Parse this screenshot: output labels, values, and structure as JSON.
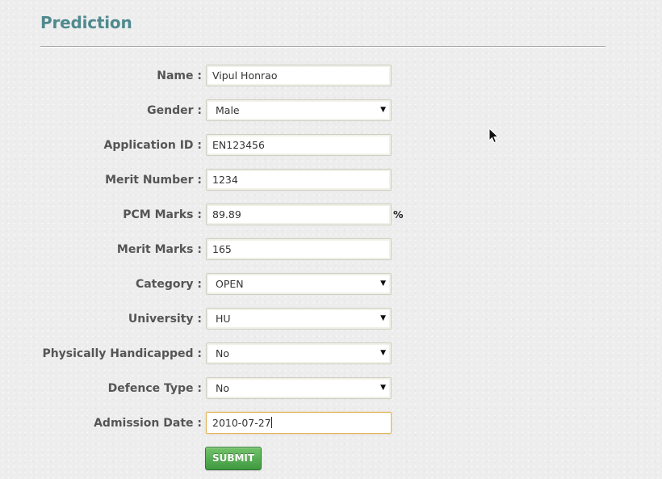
{
  "page": {
    "title": "Prediction"
  },
  "form": {
    "name": {
      "label": "Name :",
      "value": "Vipul Honrao"
    },
    "gender": {
      "label": "Gender :",
      "selected": "Male"
    },
    "application_id": {
      "label": "Application ID :",
      "value": "EN123456"
    },
    "merit_number": {
      "label": "Merit Number :",
      "value": "1234"
    },
    "pcm_marks": {
      "label": "PCM Marks :",
      "value": "89.89",
      "unit": "%"
    },
    "merit_marks": {
      "label": "Merit Marks :",
      "value": "165"
    },
    "category": {
      "label": "Category :",
      "selected": "OPEN"
    },
    "university": {
      "label": "University :",
      "selected": "HU"
    },
    "physically_handicapped": {
      "label": "Physically Handicapped :",
      "selected": "No"
    },
    "defence_type": {
      "label": "Defence Type :",
      "selected": "No"
    },
    "admission_date": {
      "label": "Admission Date :",
      "value": "2010-07-27"
    },
    "submit_label": "SUBMIT"
  },
  "icons": {
    "select_arrow": "dropdown-arrow-icon",
    "cursor": "mouse-pointer-icon"
  },
  "colors": {
    "title": "#4f8a8f",
    "submit_button": "#4caf50",
    "focus_border": "#e3b45c"
  }
}
